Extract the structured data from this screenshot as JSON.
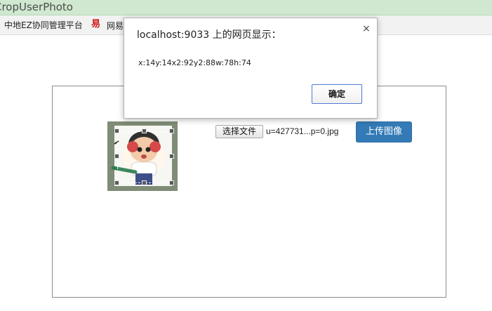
{
  "tab": {
    "title": "CropUserPhoto"
  },
  "bookmarks": [
    {
      "label": "中地EZ协同管理平台"
    },
    {
      "label": "网易邮",
      "icon": "netease-icon"
    }
  ],
  "page": {
    "file_button_label": "选择文件",
    "file_name": "u=427731...p=0.jpg",
    "upload_button_label": "上传图像"
  },
  "dialog": {
    "title": "localhost:9033 上的网页显示：",
    "message": "x:14y:14x2:92y2:88w:78h:74",
    "close_label": "×",
    "ok_label": "确定"
  },
  "colors": {
    "tab_bg": "#cfe8cf",
    "upload_button": "#337ab7",
    "dialog_ok_border": "#4c7ad6"
  }
}
